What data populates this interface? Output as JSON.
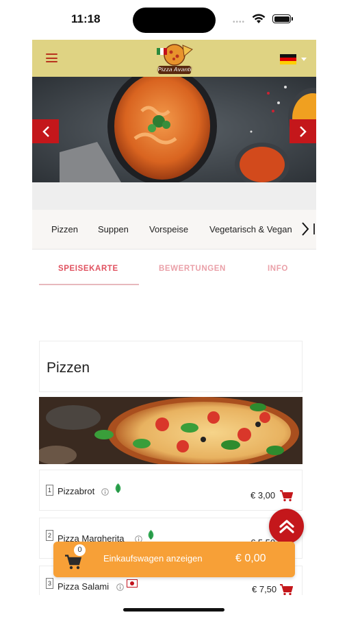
{
  "status_bar": {
    "time": "11:18"
  },
  "header": {
    "logo_text": "Pizza Avanti",
    "language_flag": "german-flag-icon"
  },
  "categories": [
    "Pizzen",
    "Suppen",
    "Vorspeise",
    "Vegetarisch & Vegan"
  ],
  "tabs": [
    {
      "label": "SPEISEKARTE",
      "color": "#e0515f",
      "active": true
    },
    {
      "label": "BEWERTUNGEN",
      "color": "#eaa0a8",
      "active": false
    },
    {
      "label": "INFO",
      "color": "#eaa0a8",
      "active": false
    }
  ],
  "section": {
    "title": "Pizzen"
  },
  "items": [
    {
      "number": "1",
      "name": "Pizzabrot",
      "price": "€ 3,00",
      "badge": "veg"
    },
    {
      "number": "2",
      "name": "Pizza Margherita",
      "price": "€ 5,50",
      "badge": "veg"
    },
    {
      "number": "3",
      "name": "Pizza Salami",
      "price": "€ 7,50",
      "badge": "halal"
    }
  ],
  "cart": {
    "count": "0",
    "label": "Einkaufswagen anzeigen",
    "total": "€ 0,00"
  },
  "colors": {
    "accent": "#c4171b",
    "header_bg": "#dfd383",
    "cart_bg": "#f7a037",
    "veg_green": "#2fa651"
  }
}
